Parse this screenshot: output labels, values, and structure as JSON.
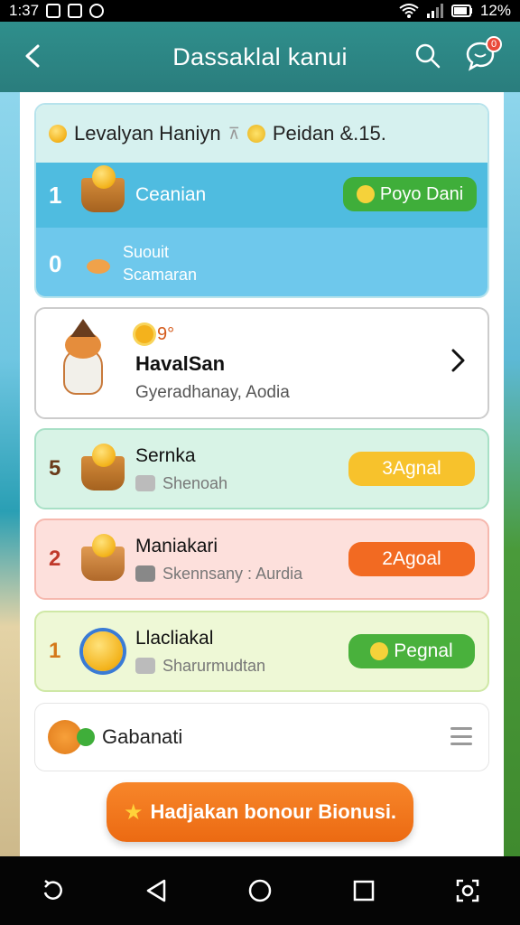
{
  "status_bar": {
    "time": "1:37",
    "battery": "12%"
  },
  "app_bar": {
    "title": "Dassaklal kanui",
    "chat_badge": "0"
  },
  "top_card": {
    "header_left": "Levalyan Haniyn",
    "header_right": "Peidan &.15.",
    "row1": {
      "number": "1",
      "label": "Ceanian",
      "button": "Poyo Dani"
    },
    "row2": {
      "number": "0",
      "line1": "Suouit",
      "line2": "Scamaran"
    }
  },
  "hero_card": {
    "badge": "9°",
    "title": "HavalSan",
    "subtitle": "Gyeradhanay, Aodia"
  },
  "list": [
    {
      "number": "5",
      "title": "Sernka",
      "subtitle": "Shenoah",
      "button": "3Agnal",
      "color": "#f7c22c"
    },
    {
      "number": "2",
      "title": "Maniakari",
      "subtitle": "Skennsany : Aurdia",
      "button": "2Agoal",
      "color": "#f26a22"
    },
    {
      "number": "1",
      "title": "Llacliakal",
      "subtitle": "Sharurmudtan",
      "button": "Pegnal",
      "color": "#49b13c"
    }
  ],
  "bottom_card": {
    "title": "Gabanati"
  },
  "cta": {
    "label": "Hadjakan bonour Bionusi."
  }
}
